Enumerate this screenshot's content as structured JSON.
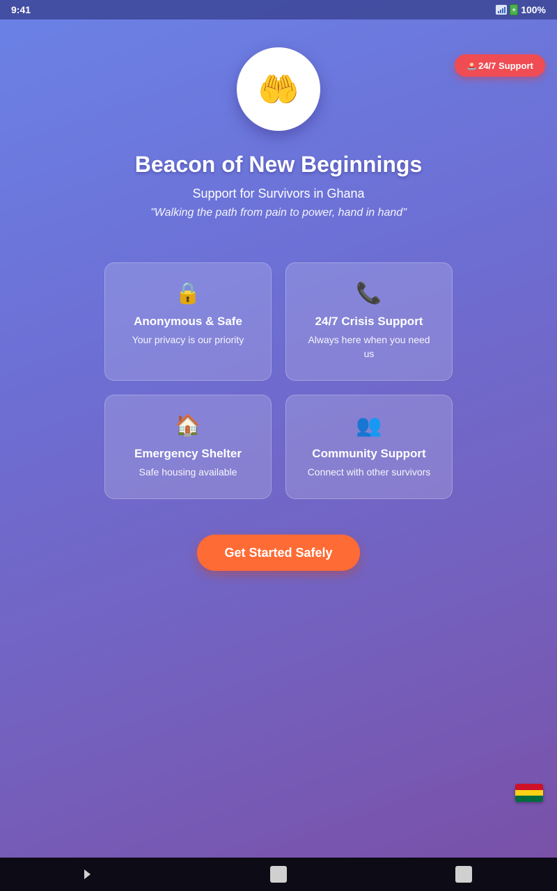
{
  "status_bar": {
    "time": "9:41",
    "battery": "100%"
  },
  "header": {
    "support_pill_icon": "🚨",
    "support_pill_label": "24/7 Support",
    "logo_emoji": "🤲",
    "title": "Beacon of New Beginnings",
    "subtitle": "Support for Survivors in Ghana",
    "tagline": "\"Walking the path from pain to power, hand in hand\""
  },
  "features": [
    {
      "icon": "🔒",
      "icon_name": "lock-icon",
      "title": "Anonymous & Safe",
      "desc": "Your privacy is our priority"
    },
    {
      "icon": "📞",
      "icon_name": "phone-icon",
      "title": "24/7 Crisis Support",
      "desc": "Always here when you need us"
    },
    {
      "icon": "🏠",
      "icon_name": "house-icon",
      "title": "Emergency Shelter",
      "desc": "Safe housing available"
    },
    {
      "icon": "👥",
      "icon_name": "people-icon",
      "title": "Community Support",
      "desc": "Connect with other survivors"
    }
  ],
  "cta": {
    "label": "Get Started Safely"
  },
  "flag_colors": [
    "#ce1126",
    "#fcd116",
    "#006b3f"
  ],
  "colors": {
    "accent": "#ff6b35",
    "support_pill": "#ef4c53"
  }
}
